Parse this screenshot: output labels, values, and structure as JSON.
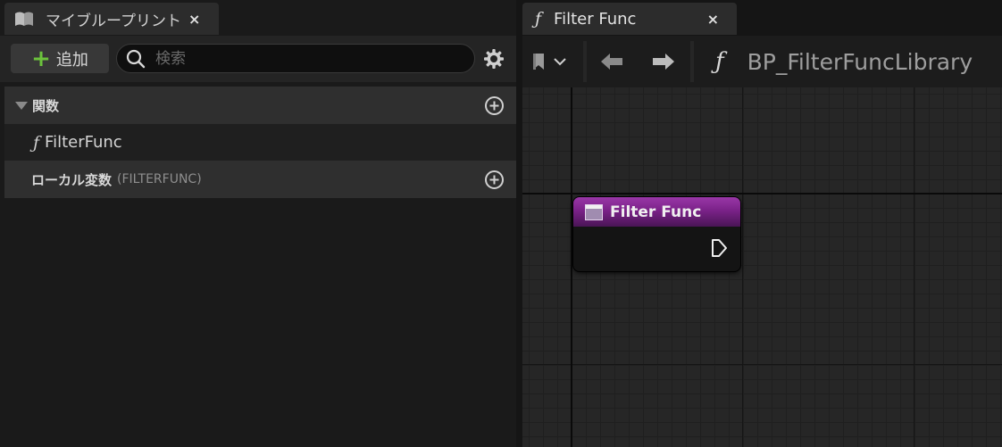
{
  "left_tab": {
    "title": "マイブループリント",
    "close": "×"
  },
  "toolbar": {
    "add_label": "追加",
    "add_plus": "+",
    "search_placeholder": "検索"
  },
  "functions_section": {
    "label": "関数"
  },
  "functions": [
    {
      "glyph": "ƒ",
      "label": "FilterFunc"
    }
  ],
  "local_vars_section": {
    "label": "ローカル変数",
    "sub": "(FILTERFUNC)"
  },
  "right_tab": {
    "glyph": "ƒ",
    "title": "Filter Func",
    "close": "×"
  },
  "graph_toolbar": {
    "glyph": "ƒ",
    "blueprint_name": "BP_FilterFuncLibrary"
  },
  "node": {
    "title": "Filter Func",
    "header_color": "#7a2288"
  },
  "colors": {
    "accent_green": "#6cc33c",
    "node_purple": "#7a2288"
  },
  "icons": [
    "book-icon",
    "search-icon",
    "gear-icon",
    "add-circle-icon",
    "bookmark-icon",
    "chevron-down-icon",
    "back-arrow-icon",
    "forward-arrow-icon",
    "exec-pin-icon"
  ]
}
